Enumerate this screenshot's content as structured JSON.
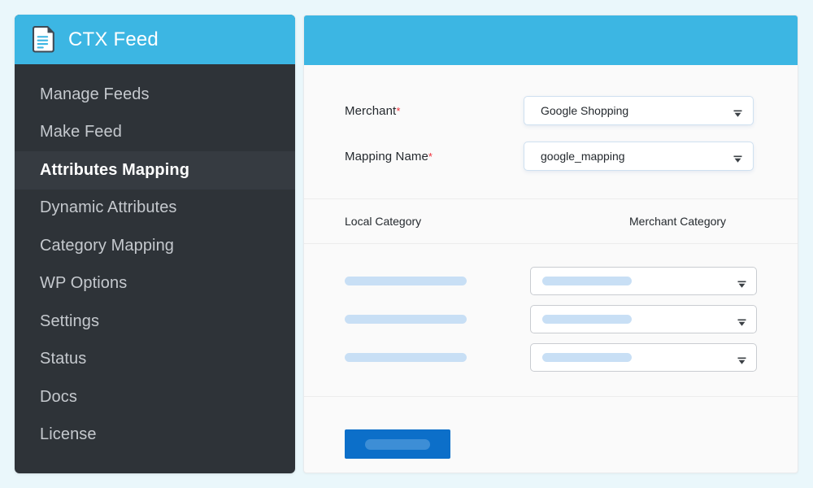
{
  "colors": {
    "page_background": "#eaf7fb",
    "sidebar_background": "#2e3338",
    "brand_blue": "#3cb6e3",
    "accent_button": "#0c6fc9",
    "required_red": "#f0323c",
    "skeleton_blue": "#c8dff5"
  },
  "sidebar": {
    "brand": {
      "title": "CTX Feed",
      "icon": "document-file-icon"
    },
    "items": [
      {
        "label": "Manage Feeds",
        "active": false
      },
      {
        "label": "Make Feed",
        "active": false
      },
      {
        "label": "Attributes Mapping",
        "active": true
      },
      {
        "label": "Dynamic Attributes",
        "active": false
      },
      {
        "label": "Category Mapping",
        "active": false
      },
      {
        "label": "WP Options",
        "active": false
      },
      {
        "label": "Settings",
        "active": false
      },
      {
        "label": "Status",
        "active": false
      },
      {
        "label": "Docs",
        "active": false
      },
      {
        "label": "License",
        "active": false
      }
    ]
  },
  "main": {
    "form": {
      "merchant": {
        "label": "Merchant",
        "required_marker": "*",
        "value": "Google Shopping",
        "caret_icon": "chevron-down-icon"
      },
      "mapping_name": {
        "label": "Mapping Name",
        "required_marker": "*",
        "value": "google_mapping",
        "caret_icon": "chevron-down-icon"
      }
    },
    "table": {
      "headers": {
        "local": "Local Category",
        "merchant": "Merchant Category"
      },
      "rows": [
        {
          "local_placeholder": "",
          "merchant_placeholder": "",
          "caret_icon": "chevron-down-icon"
        },
        {
          "local_placeholder": "",
          "merchant_placeholder": "",
          "caret_icon": "chevron-down-icon"
        },
        {
          "local_placeholder": "",
          "merchant_placeholder": "",
          "caret_icon": "chevron-down-icon"
        }
      ]
    },
    "footer": {
      "submit_label": ""
    }
  }
}
